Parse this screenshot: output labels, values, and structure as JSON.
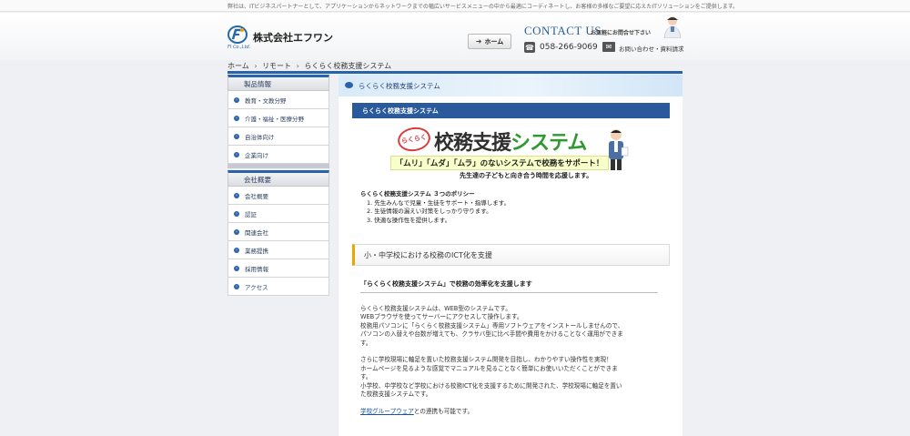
{
  "top_notice": "弊社は、ITビジネスパートナーとして、アプリケーションからネットワークまでの幅広いサービスメニューの中から最適にコーディネートし、お客様の多様なご要望に応えたITソリューションをご提供します。",
  "header": {
    "logo_sub": "FI Co.,Ltd.",
    "company": "株式会社エフワン",
    "home_button": "ホーム",
    "contact_title": "CONTACT US",
    "contact_sub": "お気軽にお問合せ下さい",
    "phone": "058-266-9069",
    "mail_label": "お問い合わせ・資料請求"
  },
  "breadcrumb": {
    "home": "ホーム",
    "sep1": "›",
    "remote": "リモート",
    "sep2": "›",
    "current": "らくらく校務支援システム"
  },
  "sidebar": {
    "section1_title": "製品情報",
    "section1_items": [
      "教育・文教分野",
      "介護・福祉・医療分野",
      "自治体向け",
      "企業向け"
    ],
    "section2_title": "会社概要",
    "section2_items": [
      "会社概要",
      "認証",
      "関連会社",
      "業務提携",
      "採用情報",
      "アクセス"
    ]
  },
  "main": {
    "page_title": "らくらく校務支援システム",
    "section_bar": "らくらく校務支援システム",
    "hero": {
      "circle": "らくらく",
      "title_a": "校務支援",
      "title_b": "システム",
      "tagline": "「ムリ」「ムダ」「ムラ」のないシステムで校務をサポート！",
      "subline": "先生達の子どもと向き合う時間を応援します。"
    },
    "policy_heading": "らくらく校務支援システム ３つのポリシー",
    "policies": [
      "1. 先生みんなで児童・生徒をサポート・指導します。",
      "2. 生徒情報の漏えい対策をしっかり守ります。",
      "3. 快適な操作性を提供します。"
    ],
    "h2": "小・中学校における校務のICT化を支援",
    "h3": "「らくらく校務支援システム」で校務の効率化を支援します",
    "para1": [
      "らくらく校務支援システムは、WEB型のシステムです。",
      "WEBブラウザを使ってサーバーにアクセスして操作します。",
      "校務用パソコンに「らくらく校務支援システム」専用ソフトウェアをインストールしませんので、",
      "パソコンの入替えや台数が増えても、クラサバ型に比べ手間や費用をかけることなく運用ができま",
      "す。"
    ],
    "para2": [
      "さらに学校現場に軸足を置いた校務支援システム開発を目指し、わかりやすい操作性を実現！",
      "ホームページを見るような感覚でマニュアルを見ることなく簡単にお使いいただくことができま",
      "す。",
      "小学校、中学校など学校における校務ICT化を支援するために開発された、学校現場に軸足を置い",
      "た校務支援システムです。"
    ],
    "link_text": "学校グループウェア",
    "link_after": "との連携も可能です。"
  },
  "colors": {
    "accent_blue": "#2a63ad",
    "section_blue": "#2a5a9c",
    "heading_orange": "#f0a400",
    "green": "#2e9a2e"
  },
  "icons": [
    "logo-mark-icon",
    "home-arrow-icon",
    "person-icon",
    "phone-icon",
    "mail-icon",
    "bullet-icon",
    "chevron-right-icon"
  ]
}
